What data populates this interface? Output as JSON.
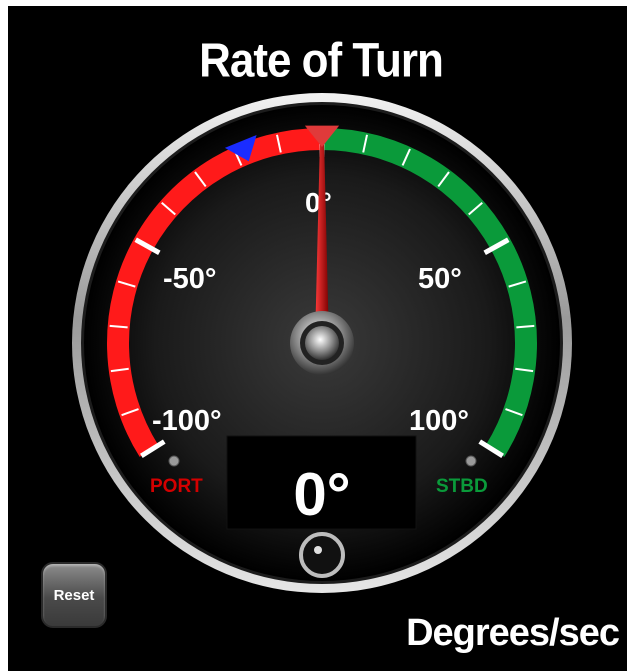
{
  "title": "Rate of Turn",
  "units": "Degrees/sec",
  "reset_label": "Reset",
  "readout": "0°",
  "gauge": {
    "scale_labels": {
      "zero": "0°",
      "minus_50": "-50°",
      "plus_50": "50°",
      "minus_100": "-100°",
      "plus_100": "100°"
    },
    "port_label": "PORT",
    "stbd_label": "STBD",
    "needle_value": 0,
    "port_marker_value": -18,
    "stbd_marker_value": 0,
    "colors": {
      "port": "#ff1a1a",
      "stbd": "#0a9a3a",
      "needle": "#c80000",
      "port_marker": "#1a2cff",
      "stbd_marker": "#e03a3a"
    }
  }
}
